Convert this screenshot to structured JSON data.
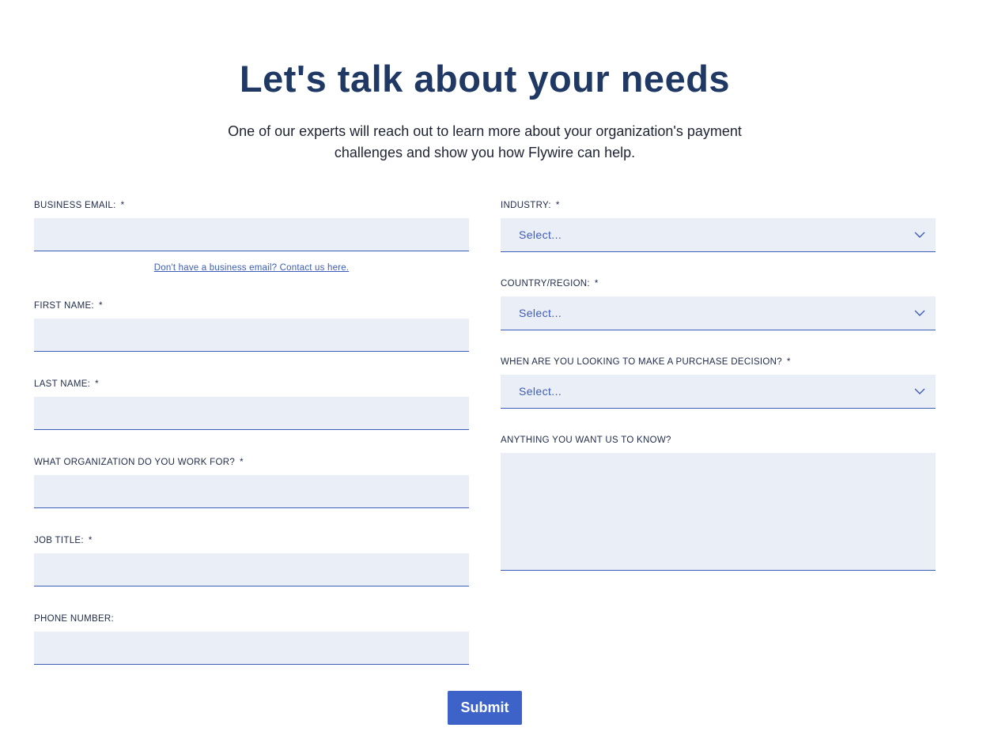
{
  "header": {
    "title": "Let's talk about your needs",
    "subtitle": "One of our experts will reach out to learn more about your organization's payment challenges and show you how Flywire can help."
  },
  "form": {
    "required_marker": "*",
    "business_email": {
      "label": "BUSINESS EMAIL:",
      "value": ""
    },
    "contact_link": "Don't have a business email? Contact us here.",
    "first_name": {
      "label": "FIRST NAME:",
      "value": ""
    },
    "last_name": {
      "label": "LAST NAME:",
      "value": ""
    },
    "organization": {
      "label": "WHAT ORGANIZATION DO YOU WORK FOR?",
      "value": ""
    },
    "job_title": {
      "label": "JOB TITLE:",
      "value": ""
    },
    "phone": {
      "label": "PHONE NUMBER:",
      "value": ""
    },
    "industry": {
      "label": "INDUSTRY:",
      "value": "Select..."
    },
    "country": {
      "label": "COUNTRY/REGION:",
      "value": "Select..."
    },
    "purchase_decision": {
      "label": "WHEN ARE YOU LOOKING TO MAKE A PURCHASE DECISION?",
      "value": "Select..."
    },
    "notes": {
      "label": "ANYTHING YOU WANT US TO KNOW?",
      "value": ""
    },
    "submit_label": "Submit"
  },
  "colors": {
    "title": "#1f3864",
    "field_bg": "#e9eef7",
    "accent": "#3d5cb8",
    "button": "#3d63c9"
  },
  "icons": {
    "select_arrow": "chevron-down-icon"
  }
}
